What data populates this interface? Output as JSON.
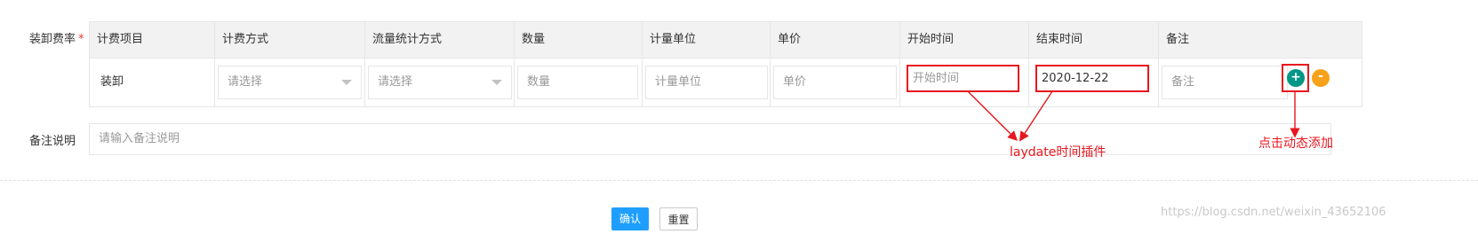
{
  "form": {
    "fee_label": "装卸费率",
    "required_mark": "*",
    "remark_label": "备注说明",
    "remark_placeholder": "请输入备注说明"
  },
  "table": {
    "headers": [
      "计费项目",
      "计费方式",
      "流量统计方式",
      "数量",
      "计量单位",
      "单价",
      "开始时间",
      "结束时间",
      "备注"
    ],
    "row": {
      "item": "装卸",
      "billing_method_placeholder": "请选择",
      "flow_method_placeholder": "请选择",
      "quantity_placeholder": "数量",
      "unit_placeholder": "计量单位",
      "price_placeholder": "单价",
      "start_time_placeholder": "开始时间",
      "end_time_value": "2020-12-22",
      "remark_placeholder": "备注"
    }
  },
  "row_actions": {
    "add_symbol": "+",
    "remove_symbol": "-"
  },
  "buttons": {
    "confirm": "确认",
    "reset": "重置"
  },
  "annotations": {
    "laydate": "laydate时间插件",
    "dynamic_add": "点击动态添加"
  },
  "watermark": "https://blog.csdn.net/weixin_43652106",
  "colors": {
    "annotation_red": "#e8161e",
    "primary_blue": "#1e9fff",
    "add_green": "#009688",
    "remove_orange": "#f7a21b"
  }
}
